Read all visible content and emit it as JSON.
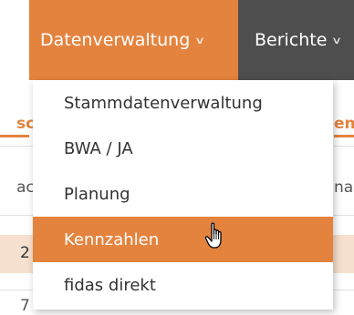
{
  "nav": {
    "items": [
      {
        "label": "Datenverwaltung",
        "active": true
      },
      {
        "label": "Berichte",
        "active": false
      }
    ],
    "active_color": "#e4833e",
    "bar_color": "#4e4e4e"
  },
  "dropdown": {
    "items": [
      {
        "label": "Stammdatenverwaltung"
      },
      {
        "label": "BWA / JA"
      },
      {
        "label": "Planung"
      },
      {
        "label": "Kennzahlen",
        "selected": true
      },
      {
        "label": "fidas direkt"
      }
    ]
  },
  "background": {
    "tab_left_fragment": "sc",
    "tab_right_fragment": "en",
    "row_left_fragment_1": "ac",
    "row_right_fragment_1": "nai",
    "row_left_fragment_2": "2",
    "row_left_fragment_3": "7"
  },
  "icons": {
    "nav_chevron": "chevron-down-icon",
    "cursor": "hand-pointer-icon"
  }
}
